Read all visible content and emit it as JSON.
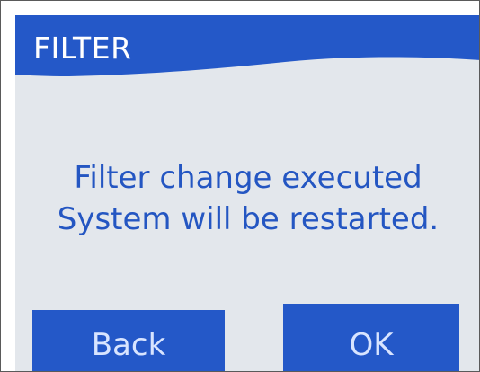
{
  "dialog": {
    "title": "FILTER",
    "message_line1": "Filter change executed",
    "message_line2": "System will be restarted."
  },
  "buttons": {
    "back_label": "Back",
    "ok_label": "OK"
  },
  "colors": {
    "titlebar": "#2458c8",
    "screen_background": "#e3e7ec",
    "message_text": "#2456c2",
    "button_background": "#2458c8",
    "button_text": "#d8e4ff"
  }
}
